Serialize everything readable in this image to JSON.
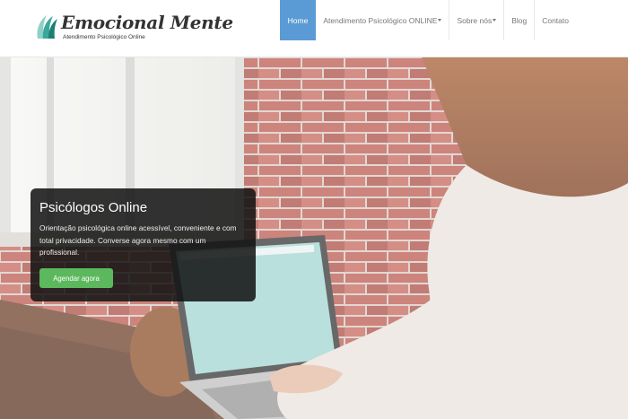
{
  "brand": {
    "name": "Emocional Mente",
    "tagline": "Atendimento Psicológico Online",
    "colors": {
      "primary": "#5b9bd5",
      "logo_mark": "#3aa79a",
      "cta": "#5cb85c"
    },
    "icon": "wave-leaf-logo-icon"
  },
  "nav": {
    "items": [
      {
        "label": "Home",
        "active": true,
        "dropdown": false
      },
      {
        "label": "Atendimento Psicológico ONLINE",
        "active": false,
        "dropdown": true
      },
      {
        "label": "Sobre nós",
        "active": false,
        "dropdown": true
      },
      {
        "label": "Blog",
        "active": false,
        "dropdown": false
      },
      {
        "label": "Contato",
        "active": false,
        "dropdown": false
      }
    ]
  },
  "hero": {
    "title": "Psicólogos Online",
    "text": "Orientação psicológica online acessível, conveniente e com total privacidade. Converse agora mesmo com um profissional.",
    "button_label": "Agendar agora"
  }
}
